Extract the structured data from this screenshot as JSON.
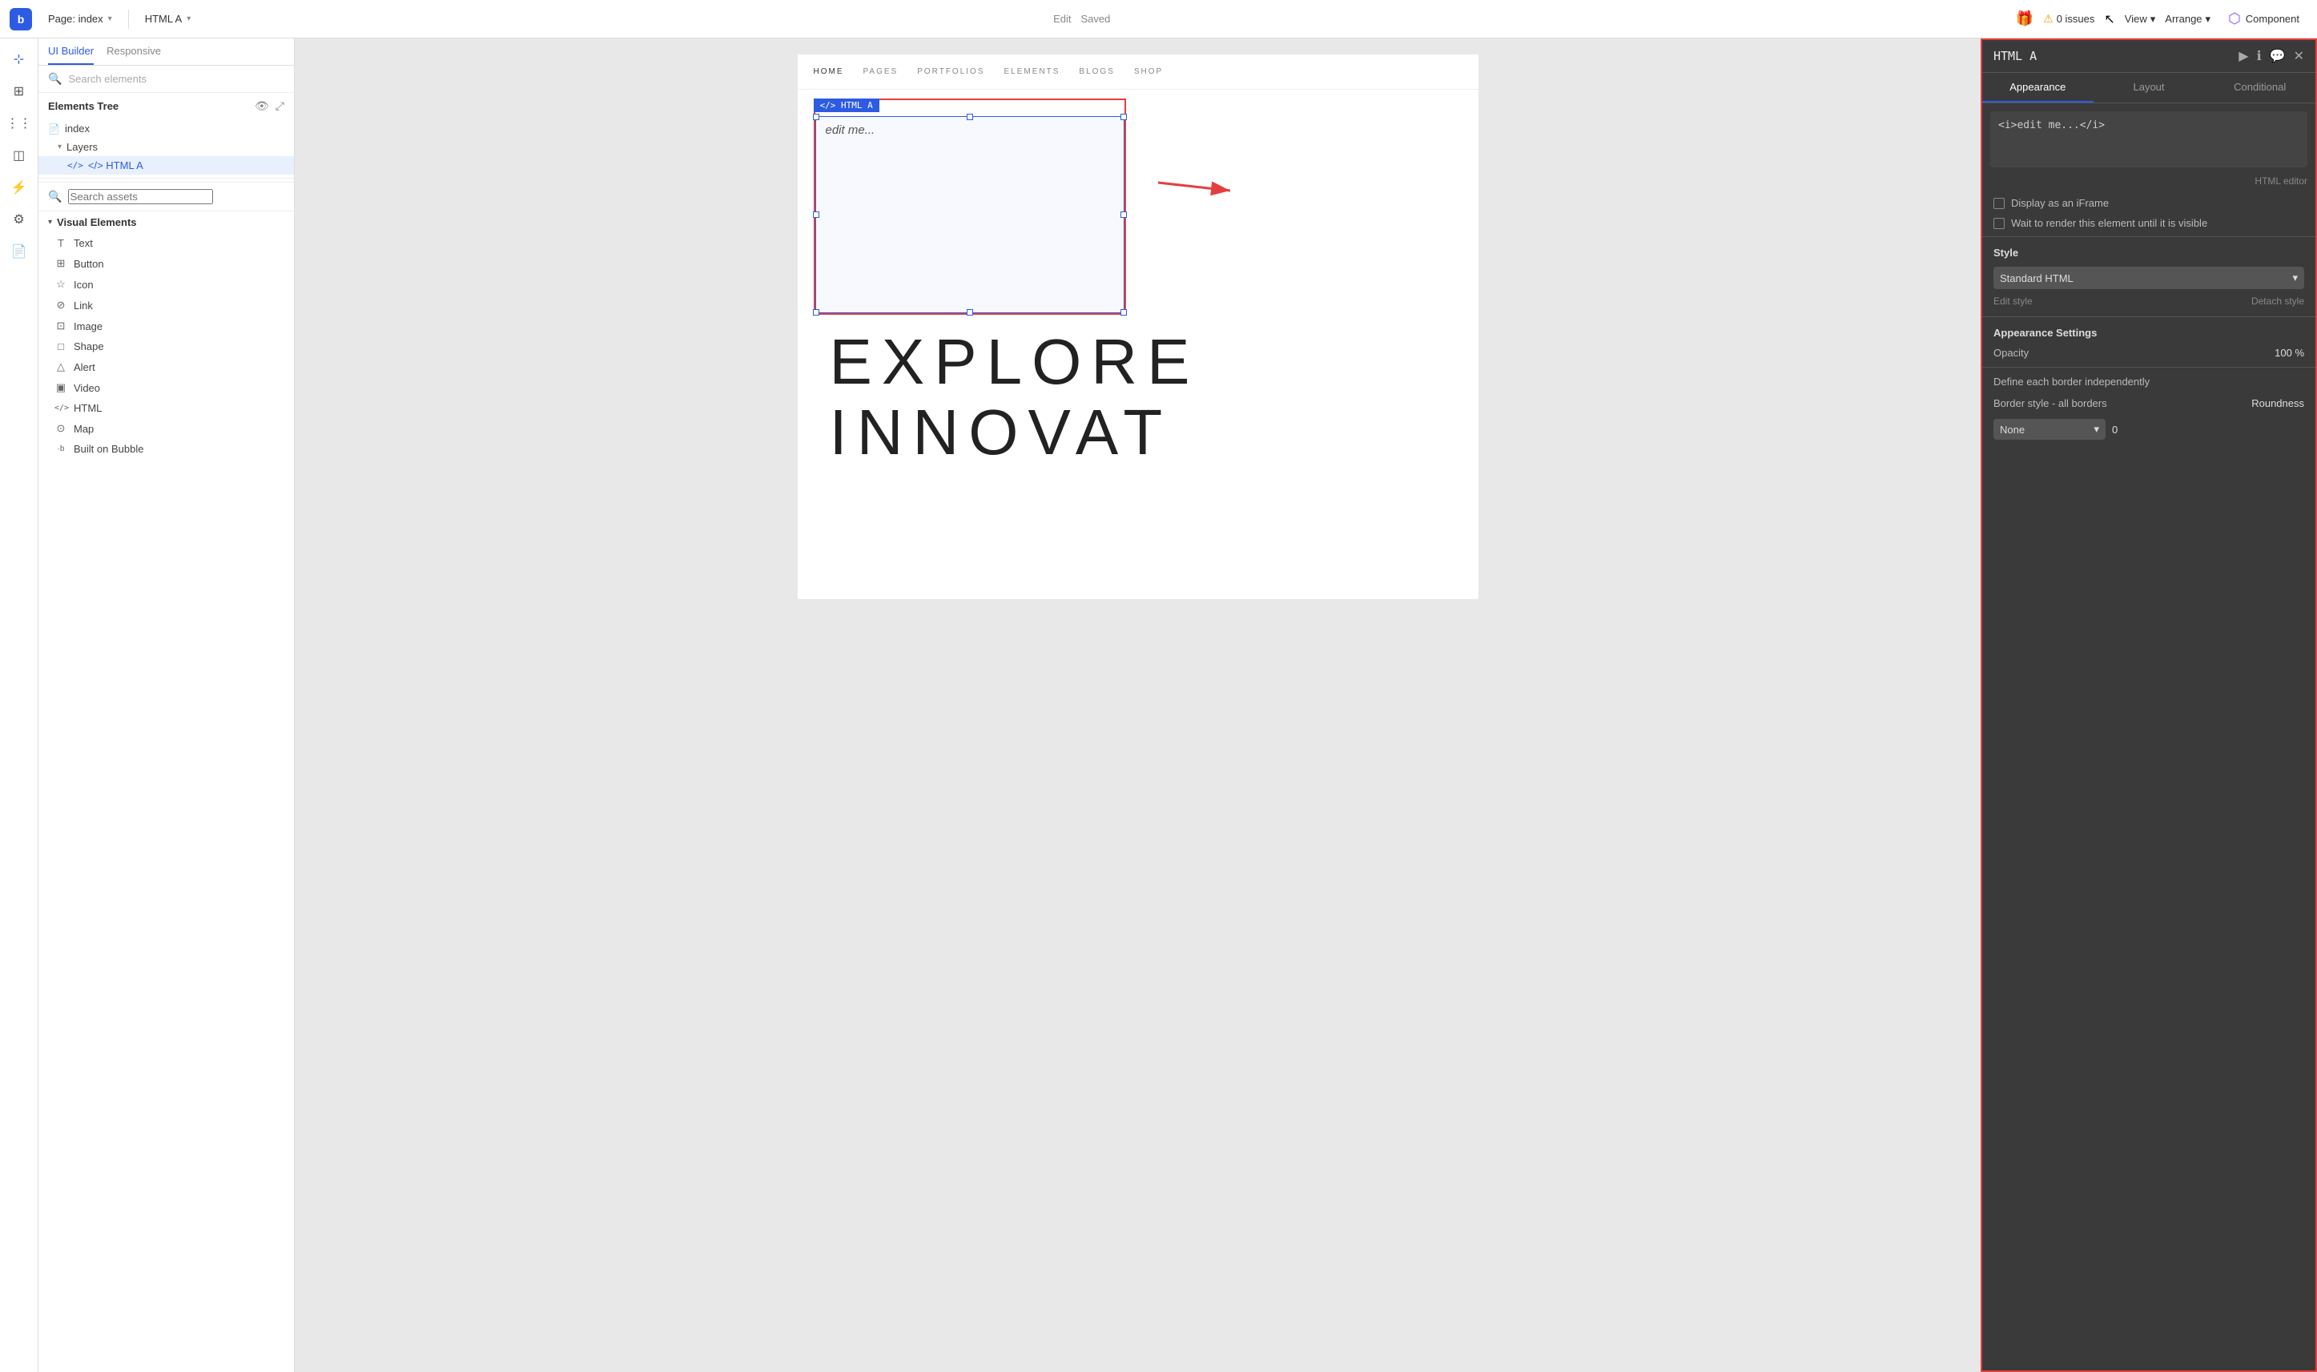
{
  "app": {
    "logo": "b",
    "page_label": "Page: index",
    "component_label": "HTML A",
    "edit_label": "Edit",
    "saved_label": "Saved",
    "issues_count": "0 issues",
    "view_label": "View",
    "arrange_label": "Arrange",
    "component_btn_label": "Component"
  },
  "left_tabs": {
    "ui_builder": "UI Builder",
    "responsive": "Responsive"
  },
  "search_elements": {
    "placeholder": "Search elements"
  },
  "elements_tree": {
    "title": "Elements Tree",
    "index_label": "index",
    "layers_label": "Layers",
    "html_a_label": "</> HTML A"
  },
  "search_assets": {
    "placeholder": "Search assets"
  },
  "visual_elements": {
    "title": "Visual Elements",
    "items": [
      {
        "icon": "T",
        "label": "Text"
      },
      {
        "icon": "⊞",
        "label": "Button"
      },
      {
        "icon": "☆",
        "label": "Icon"
      },
      {
        "icon": "🔗",
        "label": "Link"
      },
      {
        "icon": "⊡",
        "label": "Image"
      },
      {
        "icon": "□",
        "label": "Shape"
      },
      {
        "icon": "△",
        "label": "Alert"
      },
      {
        "icon": "▣",
        "label": "Video"
      },
      {
        "icon": "</>",
        "label": "HTML"
      },
      {
        "icon": "⊙",
        "label": "Map"
      },
      {
        "icon": "·b",
        "label": "Built on Bubble"
      }
    ]
  },
  "canvas": {
    "html_element_label": "</> HTML A",
    "html_element_content": "edit me...",
    "nav_items": [
      "HOME",
      "PAGES",
      "PORTFOLIOS",
      "ELEMENTS",
      "BLOGS",
      "SHOP"
    ],
    "big_text_line1": "EXPLORE",
    "big_text_line2": "INNOVAT"
  },
  "right_panel": {
    "title": "HTML A",
    "tabs": [
      "Appearance",
      "Layout",
      "Conditional"
    ],
    "code_content": "<i>edit me...</i>",
    "html_editor_label": "HTML editor",
    "display_iframe_label": "Display as an iFrame",
    "wait_render_label": "Wait to render this element until it is visible",
    "style_section_title": "Style",
    "style_value": "Standard HTML",
    "edit_style_label": "Edit style",
    "detach_style_label": "Detach style",
    "appearance_settings_title": "Appearance Settings",
    "opacity_label": "Opacity",
    "opacity_value": "100",
    "opacity_unit": "%",
    "border_label": "Define each border independently",
    "border_style_label": "Border style - all borders",
    "roundness_label": "Roundness",
    "border_value": "None",
    "roundness_value": "0"
  }
}
